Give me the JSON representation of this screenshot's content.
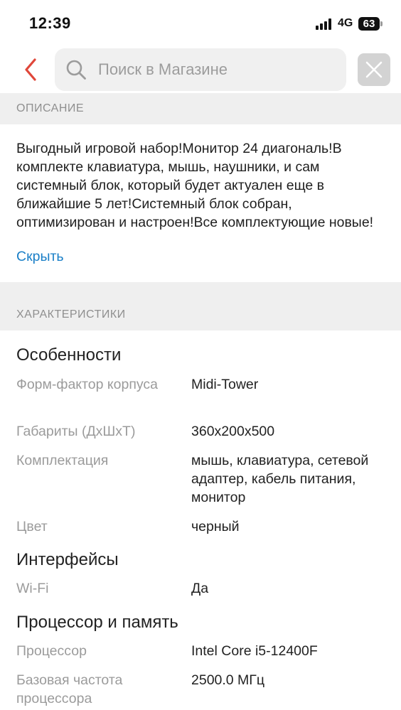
{
  "status_bar": {
    "time": "12:39",
    "network": "4G",
    "battery": "63"
  },
  "header": {
    "search_placeholder": "Поиск в Магазине"
  },
  "description_section": {
    "title": "ОПИСАНИЕ",
    "text": "Выгодный игровой набор!Монитор 24 диагональ!В комплекте клавиатура, мышь, наушники, и сам системный блок, который будет актуален еще в ближайшие 5 лет!Системный блок собран, оптимизирован и настроен!Все комплектующие новые!",
    "hide_label": "Скрыть"
  },
  "specs_section": {
    "title": "ХАРАКТЕРИСТИКИ",
    "groups": [
      {
        "title": "Особенности",
        "rows": [
          {
            "name": "Форм-фактор корпуса",
            "value": "Midi-Tower"
          },
          {
            "name": "Габариты (ДхШхТ)",
            "value": "360x200x500"
          },
          {
            "name": "Комплектация",
            "value": "мышь, клавиатура, сетевой адаптер, кабель питания, монитор"
          },
          {
            "name": "Цвет",
            "value": "черный"
          }
        ]
      },
      {
        "title": "Интерфейсы",
        "rows": [
          {
            "name": "Wi-Fi",
            "value": "Да"
          }
        ]
      },
      {
        "title": "Процессор и память",
        "rows": [
          {
            "name": "Процессор",
            "value": "Intel Core i5-12400F"
          },
          {
            "name": "Базовая частота процессора",
            "value": "2500.0 МГц"
          }
        ]
      }
    ]
  },
  "colors": {
    "accent": "#e0473a",
    "link": "#1a7fc7",
    "section_bg": "#efefef"
  },
  "icons": {
    "back": "chevron-left-icon",
    "search": "search-icon",
    "close": "close-icon"
  }
}
